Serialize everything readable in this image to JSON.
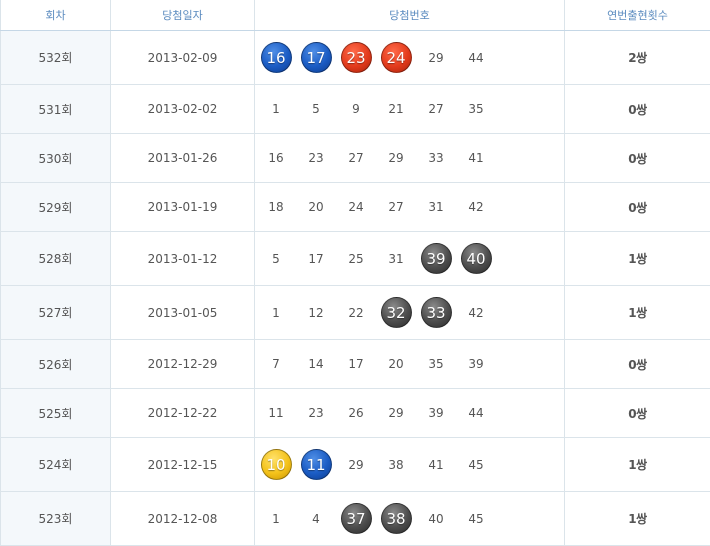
{
  "headers": [
    "회차",
    "당첨일자",
    "당첨번호",
    "연번출현횟수"
  ],
  "colors": {
    "blue": "#1b5cc4",
    "red": "#e33b1c",
    "gray": "#4d4d4d",
    "yellow": "#f4c21a",
    "header_text": "#5b8bbf"
  },
  "rows": [
    {
      "round": "532회",
      "date": "2013-02-09",
      "numbers": [
        {
          "v": "16",
          "ball": "blue"
        },
        {
          "v": "17",
          "ball": "blue"
        },
        {
          "v": "23",
          "ball": "red"
        },
        {
          "v": "24",
          "ball": "red"
        },
        {
          "v": "29",
          "ball": ""
        },
        {
          "v": "44",
          "ball": ""
        }
      ],
      "count": "2쌍",
      "h": 54
    },
    {
      "round": "531회",
      "date": "2013-02-02",
      "numbers": [
        {
          "v": "1",
          "ball": ""
        },
        {
          "v": "5",
          "ball": ""
        },
        {
          "v": "9",
          "ball": ""
        },
        {
          "v": "21",
          "ball": ""
        },
        {
          "v": "27",
          "ball": ""
        },
        {
          "v": "35",
          "ball": ""
        }
      ],
      "count": "0쌍",
      "h": 49
    },
    {
      "round": "530회",
      "date": "2013-01-26",
      "numbers": [
        {
          "v": "16",
          "ball": ""
        },
        {
          "v": "23",
          "ball": ""
        },
        {
          "v": "27",
          "ball": ""
        },
        {
          "v": "29",
          "ball": ""
        },
        {
          "v": "33",
          "ball": ""
        },
        {
          "v": "41",
          "ball": ""
        }
      ],
      "count": "0쌍",
      "h": 49
    },
    {
      "round": "529회",
      "date": "2013-01-19",
      "numbers": [
        {
          "v": "18",
          "ball": ""
        },
        {
          "v": "20",
          "ball": ""
        },
        {
          "v": "24",
          "ball": ""
        },
        {
          "v": "27",
          "ball": ""
        },
        {
          "v": "31",
          "ball": ""
        },
        {
          "v": "42",
          "ball": ""
        }
      ],
      "count": "0쌍",
      "h": 49
    },
    {
      "round": "528회",
      "date": "2013-01-12",
      "numbers": [
        {
          "v": "5",
          "ball": ""
        },
        {
          "v": "17",
          "ball": ""
        },
        {
          "v": "25",
          "ball": ""
        },
        {
          "v": "31",
          "ball": ""
        },
        {
          "v": "39",
          "ball": "gray"
        },
        {
          "v": "40",
          "ball": "gray"
        }
      ],
      "count": "1쌍",
      "h": 54
    },
    {
      "round": "527회",
      "date": "2013-01-05",
      "numbers": [
        {
          "v": "1",
          "ball": ""
        },
        {
          "v": "12",
          "ball": ""
        },
        {
          "v": "22",
          "ball": ""
        },
        {
          "v": "32",
          "ball": "gray"
        },
        {
          "v": "33",
          "ball": "gray"
        },
        {
          "v": "42",
          "ball": ""
        }
      ],
      "count": "1쌍",
      "h": 54
    },
    {
      "round": "526회",
      "date": "2012-12-29",
      "numbers": [
        {
          "v": "7",
          "ball": ""
        },
        {
          "v": "14",
          "ball": ""
        },
        {
          "v": "17",
          "ball": ""
        },
        {
          "v": "20",
          "ball": ""
        },
        {
          "v": "35",
          "ball": ""
        },
        {
          "v": "39",
          "ball": ""
        }
      ],
      "count": "0쌍",
      "h": 49
    },
    {
      "round": "525회",
      "date": "2012-12-22",
      "numbers": [
        {
          "v": "11",
          "ball": ""
        },
        {
          "v": "23",
          "ball": ""
        },
        {
          "v": "26",
          "ball": ""
        },
        {
          "v": "29",
          "ball": ""
        },
        {
          "v": "39",
          "ball": ""
        },
        {
          "v": "44",
          "ball": ""
        }
      ],
      "count": "0쌍",
      "h": 49
    },
    {
      "round": "524회",
      "date": "2012-12-15",
      "numbers": [
        {
          "v": "10",
          "ball": "yellow"
        },
        {
          "v": "11",
          "ball": "blue"
        },
        {
          "v": "29",
          "ball": ""
        },
        {
          "v": "38",
          "ball": ""
        },
        {
          "v": "41",
          "ball": ""
        },
        {
          "v": "45",
          "ball": ""
        }
      ],
      "count": "1쌍",
      "h": 54
    },
    {
      "round": "523회",
      "date": "2012-12-08",
      "numbers": [
        {
          "v": "1",
          "ball": ""
        },
        {
          "v": "4",
          "ball": ""
        },
        {
          "v": "37",
          "ball": "gray"
        },
        {
          "v": "38",
          "ball": "gray"
        },
        {
          "v": "40",
          "ball": ""
        },
        {
          "v": "45",
          "ball": ""
        }
      ],
      "count": "1쌍",
      "h": 54
    }
  ]
}
